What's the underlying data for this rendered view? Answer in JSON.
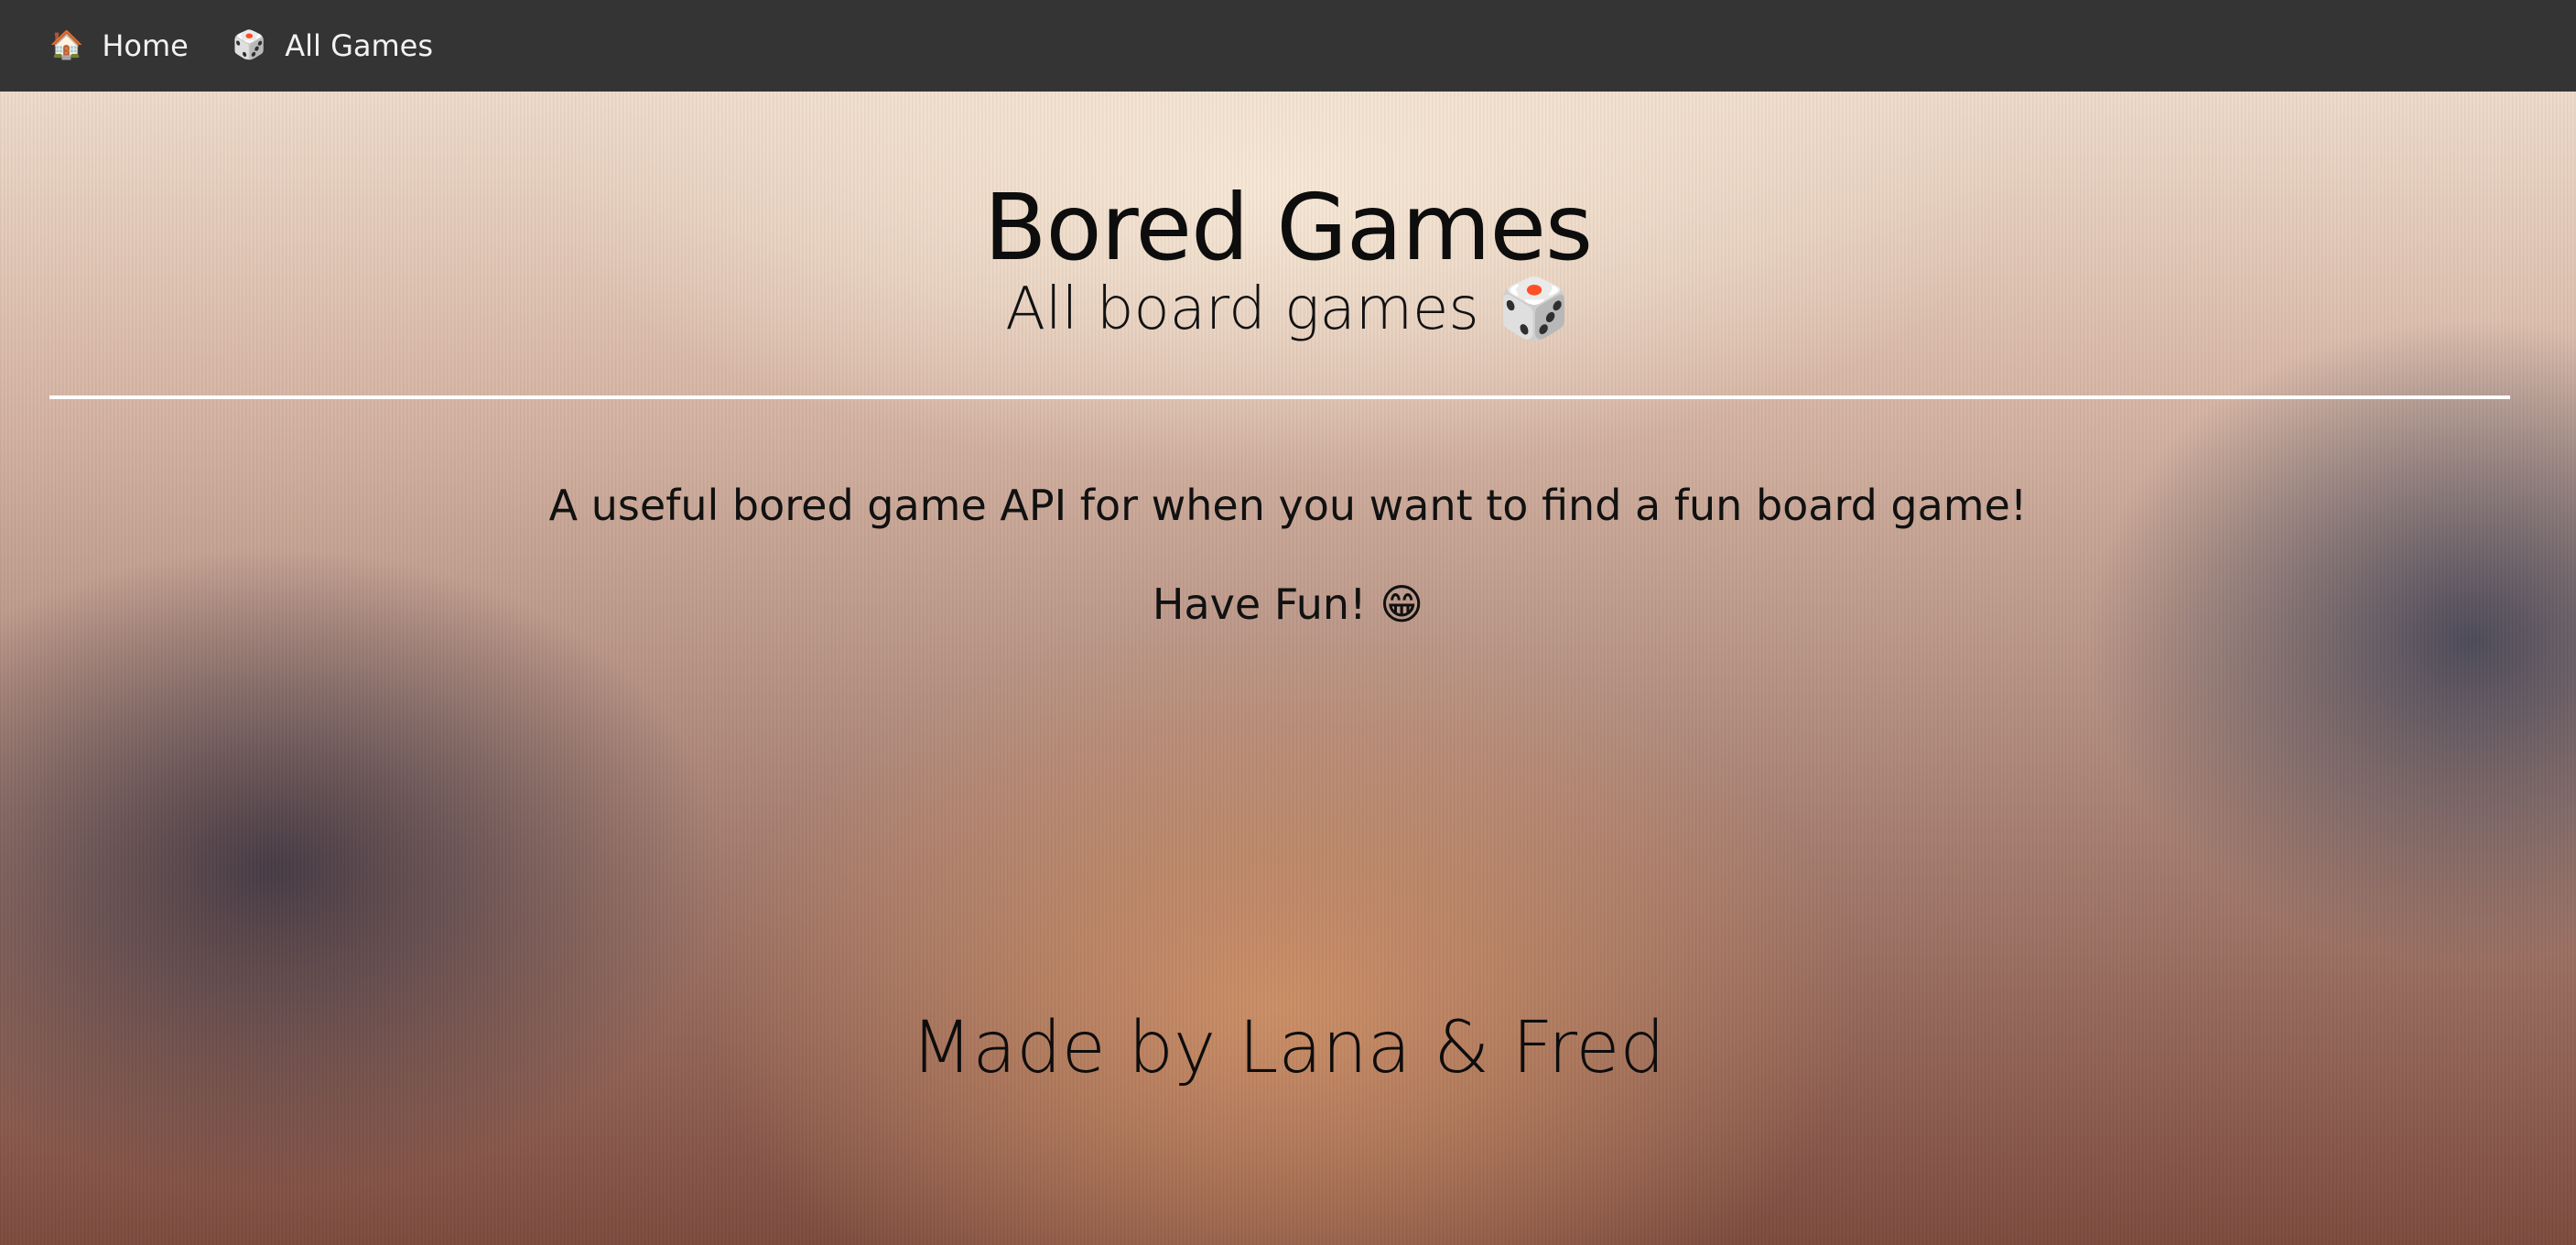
{
  "nav": {
    "items": [
      {
        "icon": "house-icon",
        "glyph": "🏠",
        "label": "Home"
      },
      {
        "icon": "dice-icon",
        "glyph": "🎲",
        "label": "All Games"
      }
    ]
  },
  "header": {
    "title": "Bored Games",
    "subtitle": "All board games",
    "subtitle_glyph": "🎲"
  },
  "main": {
    "description": "A useful bored game API for when you want to find a fun board game!",
    "fun_text": "Have Fun!",
    "fun_glyph": "😁"
  },
  "footer": {
    "credits": "Made by Lana & Fred"
  },
  "colors": {
    "navbar": "#343434",
    "nav_text": "#f2f2f2",
    "divider": "#ffffff",
    "text": "#111111"
  }
}
